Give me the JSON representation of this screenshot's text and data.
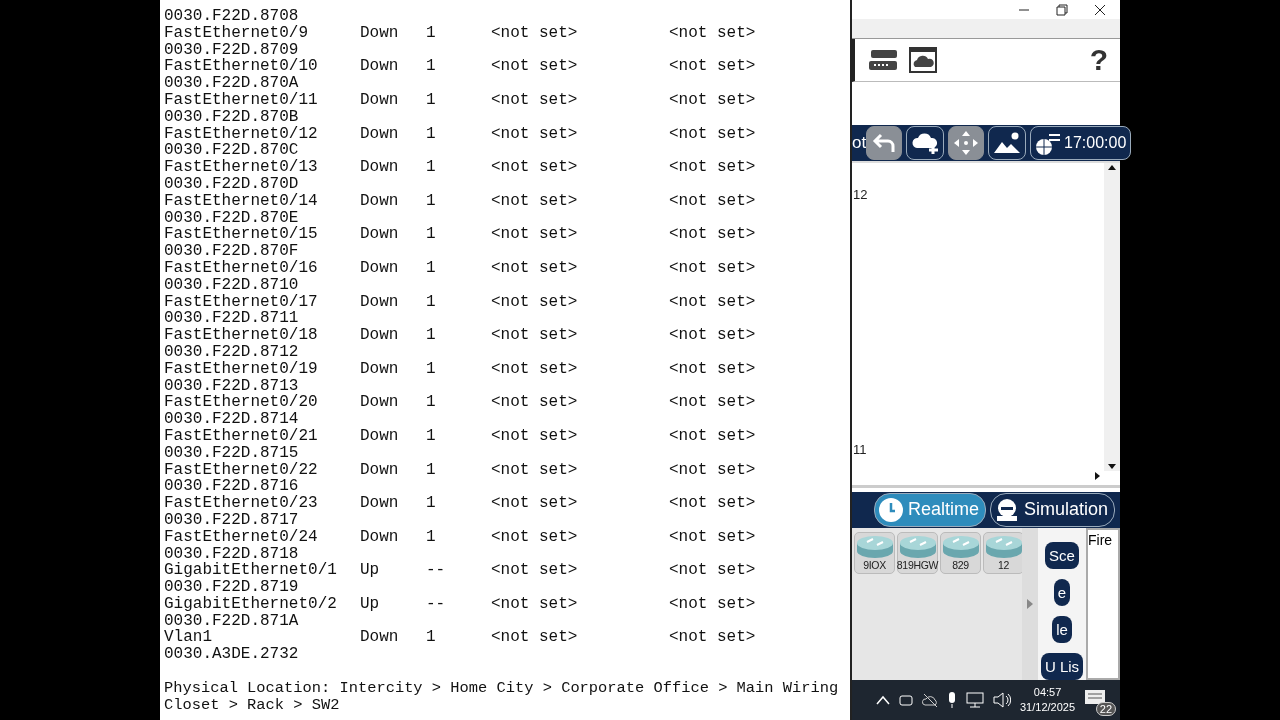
{
  "terminal": {
    "rows": [
      {
        "mac": "0030.F22D.8708"
      },
      {
        "port": "FastEthernet0/9",
        "status": "Down",
        "vlan": "1",
        "column_4": "<not set>",
        "column_5": "<not set>",
        "mac": "0030.F22D.8709"
      },
      {
        "port": "FastEthernet0/10",
        "status": "Down",
        "vlan": "1",
        "column_4": "<not set>",
        "column_5": "<not set>",
        "mac": "0030.F22D.870A"
      },
      {
        "port": "FastEthernet0/11",
        "status": "Down",
        "vlan": "1",
        "column_4": "<not set>",
        "column_5": "<not set>",
        "mac": "0030.F22D.870B"
      },
      {
        "port": "FastEthernet0/12",
        "status": "Down",
        "vlan": "1",
        "column_4": "<not set>",
        "column_5": "<not set>",
        "mac": "0030.F22D.870C"
      },
      {
        "port": "FastEthernet0/13",
        "status": "Down",
        "vlan": "1",
        "column_4": "<not set>",
        "column_5": "<not set>",
        "mac": "0030.F22D.870D"
      },
      {
        "port": "FastEthernet0/14",
        "status": "Down",
        "vlan": "1",
        "column_4": "<not set>",
        "column_5": "<not set>",
        "mac": "0030.F22D.870E"
      },
      {
        "port": "FastEthernet0/15",
        "status": "Down",
        "vlan": "1",
        "column_4": "<not set>",
        "column_5": "<not set>",
        "mac": "0030.F22D.870F"
      },
      {
        "port": "FastEthernet0/16",
        "status": "Down",
        "vlan": "1",
        "column_4": "<not set>",
        "column_5": "<not set>",
        "mac": "0030.F22D.8710"
      },
      {
        "port": "FastEthernet0/17",
        "status": "Down",
        "vlan": "1",
        "column_4": "<not set>",
        "column_5": "<not set>",
        "mac": "0030.F22D.8711"
      },
      {
        "port": "FastEthernet0/18",
        "status": "Down",
        "vlan": "1",
        "column_4": "<not set>",
        "column_5": "<not set>",
        "mac": "0030.F22D.8712"
      },
      {
        "port": "FastEthernet0/19",
        "status": "Down",
        "vlan": "1",
        "column_4": "<not set>",
        "column_5": "<not set>",
        "mac": "0030.F22D.8713"
      },
      {
        "port": "FastEthernet0/20",
        "status": "Down",
        "vlan": "1",
        "column_4": "<not set>",
        "column_5": "<not set>",
        "mac": "0030.F22D.8714"
      },
      {
        "port": "FastEthernet0/21",
        "status": "Down",
        "vlan": "1",
        "column_4": "<not set>",
        "column_5": "<not set>",
        "mac": "0030.F22D.8715"
      },
      {
        "port": "FastEthernet0/22",
        "status": "Down",
        "vlan": "1",
        "column_4": "<not set>",
        "column_5": "<not set>",
        "mac": "0030.F22D.8716"
      },
      {
        "port": "FastEthernet0/23",
        "status": "Down",
        "vlan": "1",
        "column_4": "<not set>",
        "column_5": "<not set>",
        "mac": "0030.F22D.8717"
      },
      {
        "port": "FastEthernet0/24",
        "status": "Down",
        "vlan": "1",
        "column_4": "<not set>",
        "column_5": "<not set>",
        "mac": "0030.F22D.8718"
      },
      {
        "port": "GigabitEthernet0/1",
        "status": "Up",
        "vlan": "--",
        "column_4": "<not set>",
        "column_5": "<not set>",
        "mac": "0030.F22D.8719"
      },
      {
        "port": "GigabitEthernet0/2",
        "status": "Up",
        "vlan": "--",
        "column_4": "<not set>",
        "column_5": "<not set>",
        "mac": "0030.F22D.871A"
      },
      {
        "port": "Vlan1",
        "status": "Down",
        "vlan": "1",
        "column_4": "<not set>",
        "column_5": "<not set>",
        "mac": "0030.A3DE.2732"
      }
    ],
    "location": "Physical Location: Intercity > Home City > Corporate Office > Main Wiring Closet > Rack > SW2"
  },
  "app": {
    "help": "?",
    "toolbar_label": "ot",
    "clock": "17:00:00",
    "workspace_labels": [
      "12",
      "11"
    ],
    "modes": [
      {
        "label": "Realtime",
        "kind": "realtime",
        "selected": true
      },
      {
        "label": "Simulation",
        "kind": "simulation",
        "selected": false
      }
    ],
    "devices": [
      "9IOX",
      "819HGW",
      "829",
      "12"
    ],
    "side_buttons": [
      "Sce",
      "e",
      "le",
      "U Lis"
    ],
    "side_panel_label": "Fire"
  },
  "taskbar": {
    "time": "04:57",
    "date": "31/12/2025",
    "notifications": "22"
  }
}
